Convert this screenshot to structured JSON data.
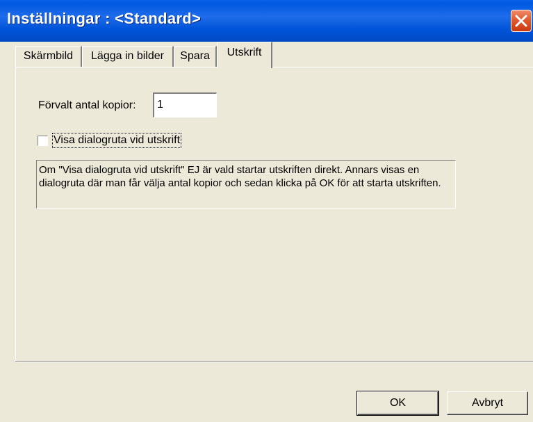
{
  "window": {
    "title": "Inställningar : <Standard>",
    "close_icon": "close-icon"
  },
  "tabs": [
    {
      "label": "Skärmbild",
      "active": false
    },
    {
      "label": "Lägga in bilder",
      "active": false
    },
    {
      "label": "Spara",
      "active": false
    },
    {
      "label": "Utskrift",
      "active": true
    }
  ],
  "print": {
    "copies_label": "Förvalt antal kopior:",
    "copies_value": "1",
    "show_dialog_label": "Visa dialogruta vid utskrift",
    "show_dialog_checked": false,
    "info_text": "Om \"Visa dialogruta vid utskrift\" EJ är vald startar utskriften direkt. Annars visas en dialogruta där man får välja antal kopior och sedan klicka på OK för att starta utskriften."
  },
  "buttons": {
    "ok_label": "OK",
    "cancel_label": "Avbryt"
  },
  "colors": {
    "titlebar": "#0054d8",
    "close_button": "#e05a30",
    "background": "#ece9d8"
  }
}
